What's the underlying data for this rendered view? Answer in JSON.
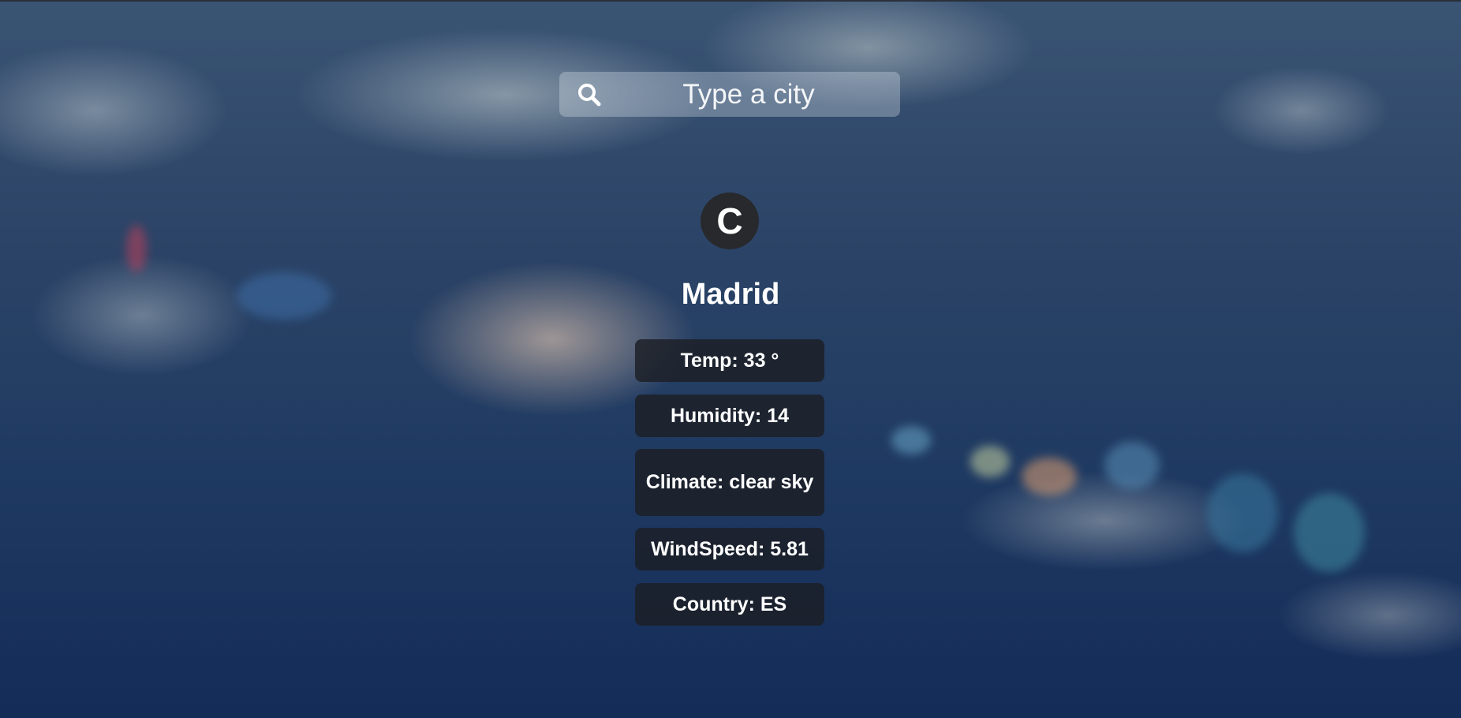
{
  "search": {
    "placeholder": "Type a city",
    "icon": "search-icon"
  },
  "unit_toggle": {
    "label": "C"
  },
  "weather": {
    "city": "Madrid",
    "temp_text": "Temp: 33 °",
    "humidity_text": "Humidity: 14",
    "climate_text": "Climate: clear sky",
    "windspeed_text": "WindSpeed: 5.81",
    "country_text": "Country: ES"
  },
  "colors": {
    "card_bg": "#1c1e24",
    "toggle_bg": "#27292c",
    "text": "#ffffff",
    "sky_dark": "#142c58"
  }
}
